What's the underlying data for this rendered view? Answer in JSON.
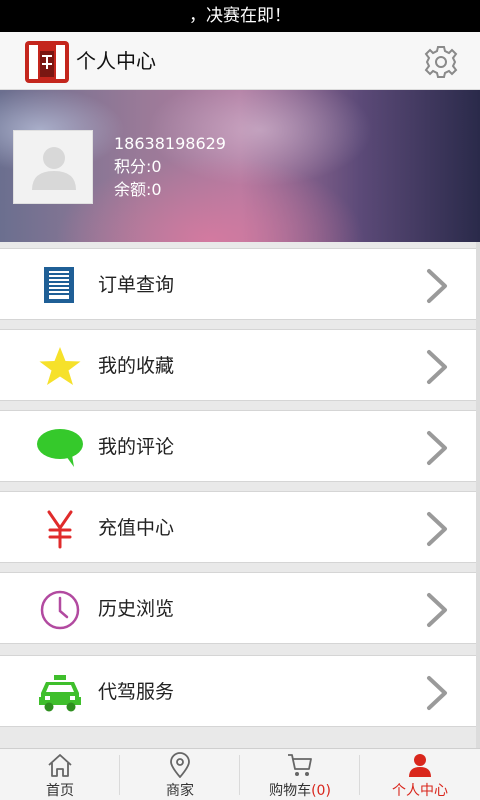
{
  "status_bar": {
    "text": "，决赛在即！"
  },
  "header": {
    "title": "个人中心",
    "logo_icon": "shop-logo-icon",
    "settings_icon": "gear-icon"
  },
  "profile": {
    "phone": "18638198629",
    "points": "积分:0",
    "balance": "余额:0",
    "avatar_icon": "user-avatar-placeholder-icon"
  },
  "menu": [
    {
      "label": "订单查询",
      "icon": "order-list-icon",
      "icon_color": "#1f5f96"
    },
    {
      "label": "我的收藏",
      "icon": "star-icon",
      "icon_color": "#f6e12a"
    },
    {
      "label": "我的评论",
      "icon": "speech-bubble-icon",
      "icon_color": "#35c92b"
    },
    {
      "label": "充值中心",
      "icon": "yen-icon",
      "icon_color": "#e02b2b"
    },
    {
      "label": "历史浏览",
      "icon": "clock-icon",
      "icon_color": "#b24aa0"
    },
    {
      "label": "代驾服务",
      "icon": "taxi-icon",
      "icon_color": "#3fbf2c"
    }
  ],
  "tabs": [
    {
      "label": "首页",
      "icon": "home-icon"
    },
    {
      "label": "商家",
      "icon": "location-pin-icon"
    },
    {
      "label": "购物车",
      "count": "(0)",
      "icon": "cart-icon"
    },
    {
      "label": "个人中心",
      "icon": "person-icon",
      "active": true
    }
  ],
  "colors": {
    "accent": "#d9261c",
    "chevron": "#9a9a9a"
  }
}
